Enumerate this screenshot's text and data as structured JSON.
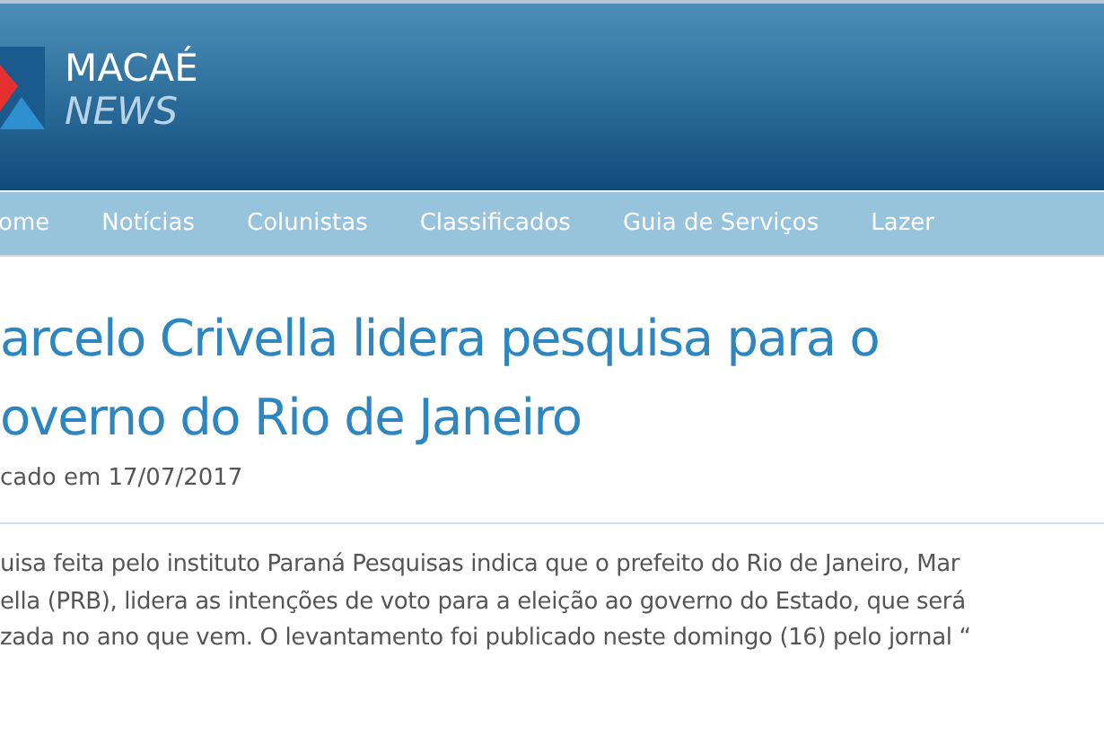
{
  "header": {
    "logo": {
      "line_1": "MACAÉ",
      "line_2": "NEWS"
    }
  },
  "nav": [
    "ome",
    "Notícias",
    "Colunistas",
    "Classificados",
    "Guia de Serviços",
    "Lazer"
  ],
  "article": {
    "title_lines": [
      "arcelo Crivella lidera pesquisa para o",
      "overno do Rio de Janeiro"
    ],
    "date": "cado em 17/07/2017",
    "body_lines": [
      "uisa feita pelo instituto Paraná Pesquisas indica que o prefeito do Rio de Janeiro, Mar",
      "ella (PRB), lidera as intenções de voto para a eleição ao governo do Estado, que será",
      "zada no ano que vem. O levantamento foi publicado neste domingo (16) pelo jornal “"
    ]
  }
}
